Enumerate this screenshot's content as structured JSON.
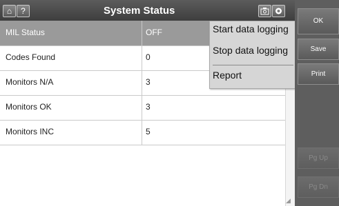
{
  "titlebar": {
    "title": "System Status",
    "home_icon": "home-icon",
    "help_label": "?",
    "camera_icon": "camera-icon",
    "settings_icon": "gear-icon"
  },
  "table": {
    "header": {
      "name": "MIL Status",
      "value": "OFF"
    },
    "rows": [
      {
        "name": "Codes Found",
        "value": "0"
      },
      {
        "name": "Monitors N/A",
        "value": "3"
      },
      {
        "name": "Monitors OK",
        "value": "3"
      },
      {
        "name": "Monitors INC",
        "value": "5"
      }
    ]
  },
  "popup_menu": {
    "items": [
      "Start data logging",
      "Stop data logging",
      "Report"
    ]
  },
  "side_buttons": {
    "ok": "OK",
    "save": "Save",
    "print": "Print",
    "page_up": "Pg Up",
    "page_down": "Pg Dn"
  }
}
